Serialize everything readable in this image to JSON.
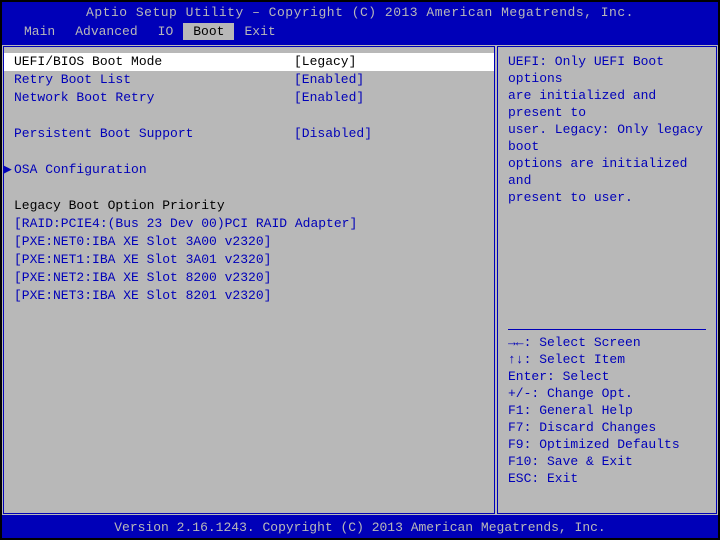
{
  "title": "Aptio Setup Utility – Copyright (C) 2013 American Megatrends, Inc.",
  "menu": {
    "items": [
      "Main",
      "Advanced",
      "IO",
      "Boot",
      "Exit"
    ],
    "active": "Boot"
  },
  "settings": {
    "boot_mode": {
      "label": "UEFI/BIOS Boot Mode",
      "value": "[Legacy]"
    },
    "retry_boot": {
      "label": "Retry Boot List",
      "value": "[Enabled]"
    },
    "net_retry": {
      "label": "Network Boot Retry",
      "value": "[Enabled]"
    },
    "persistent": {
      "label": "Persistent Boot Support",
      "value": "[Disabled]"
    }
  },
  "submenu": {
    "osa": "OSA Configuration"
  },
  "section_header": "Legacy Boot Option Priority",
  "boot_options": [
    "[RAID:PCIE4:(Bus 23 Dev 00)PCI RAID Adapter]",
    "[PXE:NET0:IBA XE Slot 3A00 v2320]",
    "[PXE:NET1:IBA XE Slot 3A01 v2320]",
    "[PXE:NET2:IBA XE Slot 8200 v2320]",
    "[PXE:NET3:IBA XE Slot 8201 v2320]"
  ],
  "help": {
    "text_lines": [
      "UEFI: Only UEFI Boot options",
      "are initialized and present to",
      "user. Legacy: Only legacy boot",
      "options are initialized and",
      "present to user."
    ],
    "keys": [
      "→←: Select Screen",
      "↑↓: Select Item",
      "Enter: Select",
      "+/-: Change Opt.",
      "F1: General Help",
      "F7: Discard Changes",
      "F9: Optimized Defaults",
      "F10: Save & Exit",
      "ESC: Exit"
    ]
  },
  "footer": "Version 2.16.1243. Copyright (C) 2013 American Megatrends, Inc."
}
